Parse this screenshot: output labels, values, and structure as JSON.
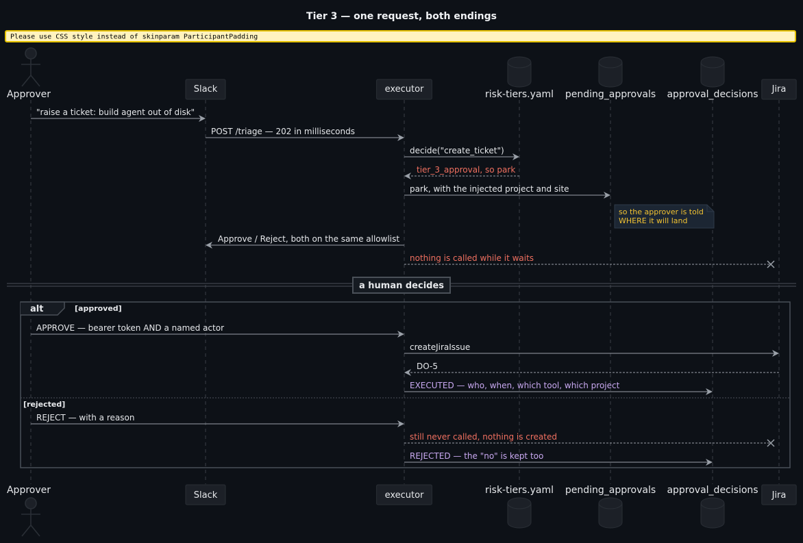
{
  "title": "Tier 3 — one request, both endings",
  "warning": "Please use CSS style instead of skinparam ParticipantPadding",
  "colors": {
    "background": "#0d1117",
    "lifeline": "#3a3f47",
    "arrow": "#9aa0a8",
    "text": "#e6e8eb",
    "error_text": "#f07060",
    "audit_text": "#c8a8f0",
    "note_text": "#f1c232",
    "note_fill": "#1c2633",
    "participant_fill": "#1c2027"
  },
  "participants": [
    {
      "id": "approver",
      "name": "Approver",
      "shape": "actor"
    },
    {
      "id": "slack",
      "name": "Slack",
      "shape": "box"
    },
    {
      "id": "executor",
      "name": "executor",
      "shape": "box"
    },
    {
      "id": "risk",
      "name": "risk-tiers.yaml",
      "shape": "database"
    },
    {
      "id": "pending",
      "name": "pending_approvals",
      "shape": "database"
    },
    {
      "id": "decisions",
      "name": "approval_decisions",
      "shape": "database"
    },
    {
      "id": "jira",
      "name": "Jira",
      "shape": "box"
    }
  ],
  "messages": [
    {
      "from": "approver",
      "to": "slack",
      "text": "\"raise a ticket: build agent out of disk\"",
      "style": "solid",
      "color": "text"
    },
    {
      "from": "slack",
      "to": "executor",
      "text": "POST /triage — 202 in milliseconds",
      "style": "solid",
      "color": "text"
    },
    {
      "from": "executor",
      "to": "risk",
      "text": "decide(\"create_ticket\")",
      "style": "solid",
      "color": "text"
    },
    {
      "from": "risk",
      "to": "executor",
      "text": "tier_3_approval, so park",
      "style": "dashed",
      "color": "error"
    },
    {
      "from": "executor",
      "to": "pending",
      "text": "park, with the injected project and site",
      "style": "solid",
      "color": "text"
    },
    {
      "from": "executor",
      "to": "slack",
      "text": "Approve / Reject, both on the same allowlist",
      "style": "solid",
      "color": "text"
    },
    {
      "from": "executor",
      "to": "jira",
      "text": "nothing is called while it waits",
      "style": "dashed",
      "color": "error",
      "lost": true
    }
  ],
  "note": {
    "lines": [
      "so the approver is told",
      "WHERE it will land"
    ]
  },
  "divider": "a human decides",
  "alt": {
    "label": "alt",
    "approved": {
      "guard": "[approved]",
      "messages": [
        {
          "from": "approver",
          "to": "executor",
          "text": "APPROVE — bearer token AND a named actor",
          "style": "solid",
          "color": "text"
        },
        {
          "from": "executor",
          "to": "jira",
          "text": "createJiraIssue",
          "style": "solid",
          "color": "text"
        },
        {
          "from": "jira",
          "to": "executor",
          "text": "DO-5",
          "style": "dashed",
          "color": "text"
        },
        {
          "from": "executor",
          "to": "decisions",
          "text": "EXECUTED — who, when, which tool, which project",
          "style": "solid",
          "color": "audit"
        }
      ]
    },
    "rejected": {
      "guard": "[rejected]",
      "messages": [
        {
          "from": "approver",
          "to": "executor",
          "text": "REJECT — with a reason",
          "style": "solid",
          "color": "text"
        },
        {
          "from": "executor",
          "to": "jira",
          "text": "still never called, nothing is created",
          "style": "dashed",
          "color": "error",
          "lost": true
        },
        {
          "from": "executor",
          "to": "decisions",
          "text": "REJECTED — the \"no\" is kept too",
          "style": "solid",
          "color": "audit"
        }
      ]
    }
  }
}
